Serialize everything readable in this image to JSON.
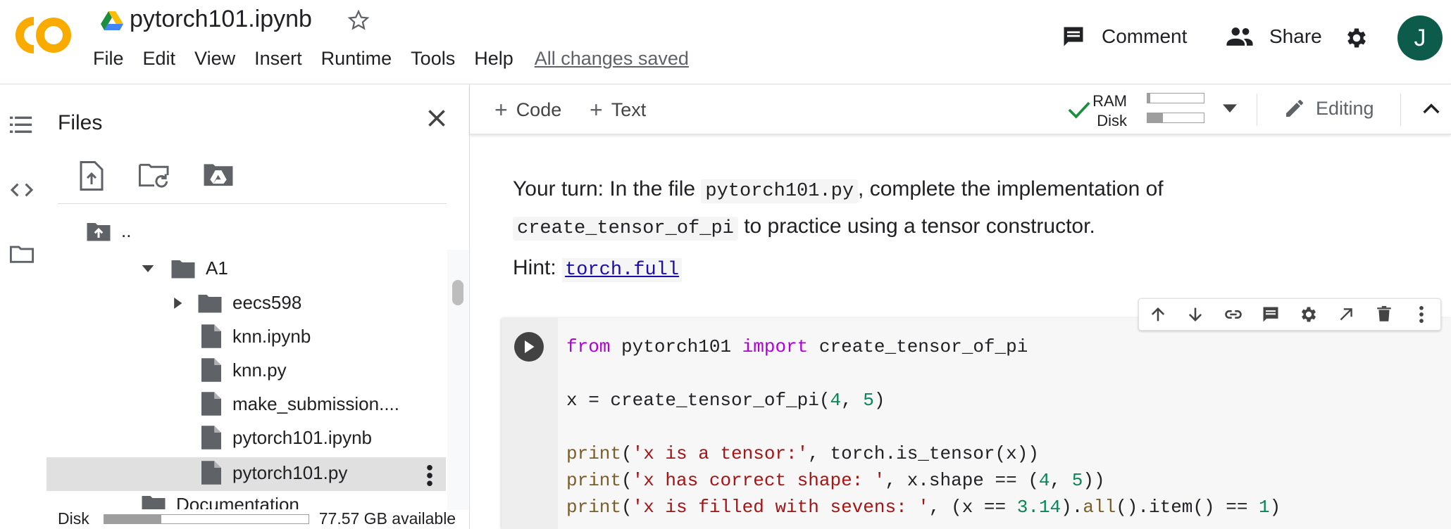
{
  "header": {
    "title": "pytorch101.ipynb",
    "menu": [
      "File",
      "Edit",
      "View",
      "Insert",
      "Runtime",
      "Tools",
      "Help"
    ],
    "save_status": "All changes saved",
    "comment_label": "Comment",
    "share_label": "Share",
    "avatar_initial": "J",
    "avatar_color": "#0d5c4b"
  },
  "files_panel": {
    "title": "Files",
    "tree": [
      {
        "label": "..",
        "type": "parent-folder"
      },
      {
        "label": "A1",
        "type": "folder",
        "expanded": true
      },
      {
        "label": "eecs598",
        "type": "folder",
        "expanded": false
      },
      {
        "label": "knn.ipynb",
        "type": "file"
      },
      {
        "label": "knn.py",
        "type": "file"
      },
      {
        "label": "make_submission....",
        "type": "file"
      },
      {
        "label": "pytorch101.ipynb",
        "type": "file"
      },
      {
        "label": "pytorch101.py",
        "type": "file",
        "selected": true
      },
      {
        "label": "Documentation",
        "type": "folder"
      }
    ],
    "disk_label": "Disk",
    "disk_available": "77.57 GB available",
    "disk_used_fraction": 0.28
  },
  "toolbar": {
    "code_label": "Code",
    "text_label": "Text",
    "ram_label": "RAM",
    "disk_label": "Disk",
    "ram_fraction": 0.05,
    "disk_fraction": 0.28,
    "editing_label": "Editing"
  },
  "notebook": {
    "text_cell": {
      "p1_start": "Your turn: In the file ",
      "p1_code1": "pytorch101.py",
      "p1_mid": ", complete the implementation of",
      "p1_code2": "create_tensor_of_pi",
      "p1_end": " to practice using a tensor constructor.",
      "hint_label": "Hint: ",
      "hint_link": "torch.full"
    },
    "code_lines": [
      "from pytorch101 import create_tensor_of_pi",
      "",
      "x = create_tensor_of_pi(4, 5)",
      "",
      "print('x is a tensor:', torch.is_tensor(x))",
      "print('x has correct shape: ', x.shape == (4, 5))",
      "print('x is filled with sevens: ', (x == 3.14).all().item() == 1)"
    ]
  },
  "colors": {
    "accent_orange": "#f9ab00",
    "check_green": "#1e8e3e",
    "keyword": "#af00db",
    "number": "#098658",
    "string": "#a31515"
  }
}
